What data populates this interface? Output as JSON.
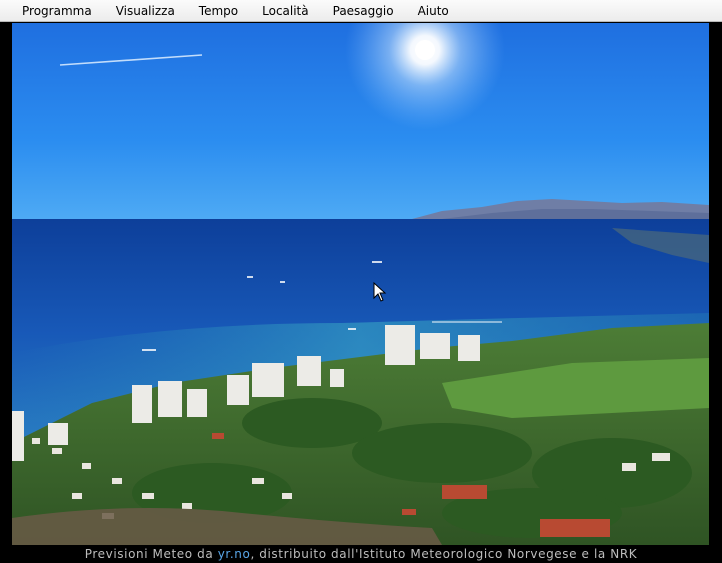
{
  "menu": {
    "items": [
      "Programma",
      "Visualizza",
      "Tempo",
      "Località",
      "Paesaggio",
      "Aiuto"
    ]
  },
  "scene": {
    "description_icons": [
      "sun-icon",
      "moon-icon",
      "mouse-cursor-icon"
    ]
  },
  "footer": {
    "prefix": "Previsioni Meteo da ",
    "link": "yr.no",
    "suffix": ", distribuito dall'Istituto Meteorologico Norvegese e la NRK"
  }
}
